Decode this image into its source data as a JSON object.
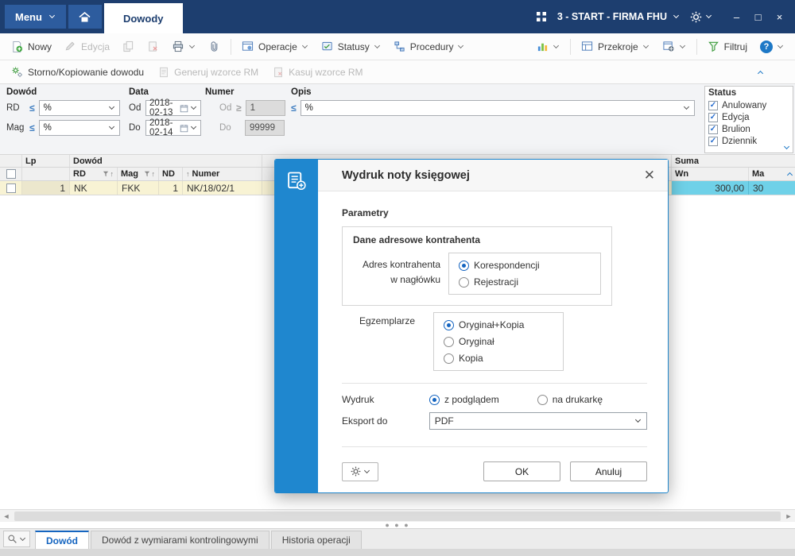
{
  "titlebar": {
    "menu_label": "Menu",
    "tab_label": "Dowody",
    "company_label": "3 - START - FIRMA FHU",
    "minimize_glyph": "–",
    "maximize_glyph": "□",
    "close_glyph": "×"
  },
  "toolbar": {
    "new_label": "Nowy",
    "edit_label": "Edycja",
    "operations_label": "Operacje",
    "statuses_label": "Statusy",
    "procedures_label": "Procedury",
    "sections_label": "Przekroje",
    "filter_label": "Filtruj",
    "help_glyph": "?"
  },
  "actionbar": {
    "storno_label": "Storno/Kopiowanie dowodu",
    "generate_label": "Generuj wzorce RM",
    "delete_label": "Kasuj wzorce RM"
  },
  "filters": {
    "document_group": "Dowód",
    "rd_label": "RD",
    "rd_operator": "≤",
    "rd_value": "%",
    "mag_label": "Mag",
    "mag_operator": "≤",
    "mag_value": "%",
    "date_group": "Data",
    "date_from_label": "Od",
    "date_from_value": "2018-02-13",
    "date_to_label": "Do",
    "date_to_value": "2018-02-14",
    "number_group": "Numer",
    "number_from_label": "Od",
    "number_from_operator": "≥",
    "number_from_value": "1",
    "number_to_label": "Do",
    "number_to_value": "99999",
    "description_group": "Opis",
    "description_operator": "≤",
    "description_value": "%",
    "status_group": "Status",
    "status_items": [
      {
        "label": "Anulowany",
        "checked": true
      },
      {
        "label": "Edycja",
        "checked": true
      },
      {
        "label": "Brulion",
        "checked": true
      },
      {
        "label": "Dziennik",
        "checked": true
      }
    ]
  },
  "table": {
    "group_document": "Dowód",
    "group_sum": "Suma",
    "col_lp": "Lp",
    "col_rd": "RD",
    "col_mag": "Mag",
    "col_nd": "ND",
    "col_number": "Numer",
    "col_wn": "Wn",
    "col_ma": "Ma",
    "sort_glyph": "↑",
    "row": {
      "lp": "1",
      "rd": "NK",
      "mag": "FKK",
      "nd": "1",
      "number": "NK/18/02/1",
      "wn": "300,00",
      "ma": "30"
    }
  },
  "dialog": {
    "title": "Wydruk noty księgowej",
    "close_glyph": "✕",
    "section_params": "Parametry",
    "group_address": "Dane adresowe kontrahenta",
    "address_label": "Adres kontrahenta w nagłówku",
    "address_options": [
      {
        "label": "Korespondencji",
        "selected": true
      },
      {
        "label": "Rejestracji",
        "selected": false
      }
    ],
    "copies_label": "Egzemplarze",
    "copies_options": [
      {
        "label": "Oryginał+Kopia",
        "selected": true
      },
      {
        "label": "Oryginał",
        "selected": false
      },
      {
        "label": "Kopia",
        "selected": false
      }
    ],
    "print_label": "Wydruk",
    "print_options": [
      {
        "label": "z podglądem",
        "selected": true
      },
      {
        "label": "na drukarkę",
        "selected": false
      }
    ],
    "export_label": "Eksport do",
    "export_value": "PDF",
    "ok_label": "OK",
    "cancel_label": "Anuluj"
  },
  "bottom": {
    "tabs": [
      {
        "label": "Dowód",
        "active": true
      },
      {
        "label": "Dowód z wymiarami kontrolingowymi",
        "active": false
      },
      {
        "label": "Historia operacji",
        "active": false
      }
    ]
  },
  "colors": {
    "titlebar": "#1d3e6f",
    "accent_blue": "#1e86cc",
    "row_yellow": "#f8f3d4",
    "sum_cyan": "#6fd1e8"
  }
}
